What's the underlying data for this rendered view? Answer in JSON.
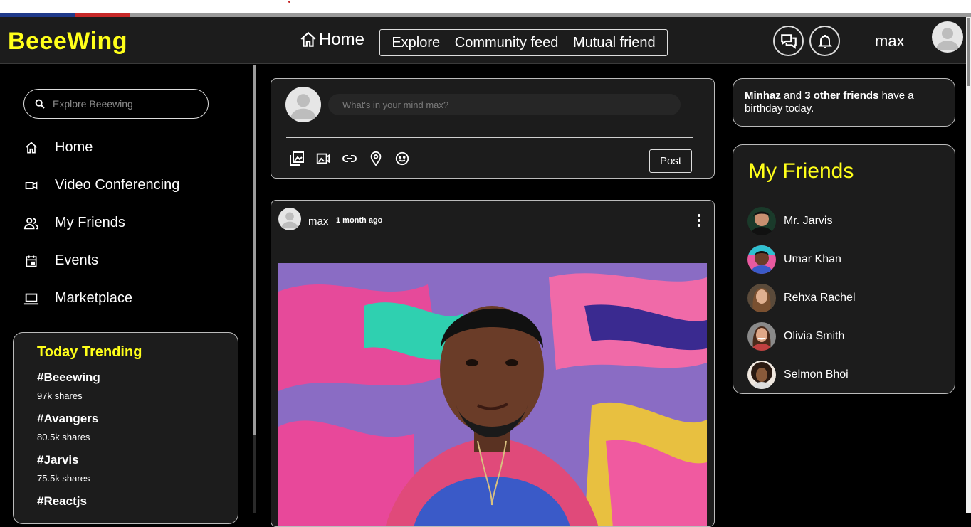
{
  "header": {
    "logo": "BeeeWing",
    "home_label": "Home",
    "nav_links": [
      "Explore",
      "Community feed",
      "Mutual friend"
    ],
    "username": "max"
  },
  "sidebar": {
    "search_placeholder": "Explore Beeewing",
    "items": [
      {
        "label": "Home",
        "icon": "home-icon"
      },
      {
        "label": "Video Conferencing",
        "icon": "video-camera-icon"
      },
      {
        "label": "My Friends",
        "icon": "people-icon"
      },
      {
        "label": "Events",
        "icon": "calendar-icon"
      },
      {
        "label": "Marketplace",
        "icon": "laptop-icon"
      }
    ],
    "trending": {
      "title": "Today Trending",
      "items": [
        {
          "tag": "#Beeewing",
          "shares": "97k shares"
        },
        {
          "tag": "#Avangers",
          "shares": "80.5k shares"
        },
        {
          "tag": "#Jarvis",
          "shares": "75.5k shares"
        },
        {
          "tag": "#Reactjs",
          "shares": ""
        }
      ]
    }
  },
  "composer": {
    "placeholder": "What's in your mind max?",
    "post_label": "Post",
    "tools": [
      "photo-library-icon",
      "image-icon",
      "link-icon",
      "location-pin-icon",
      "emoji-icon"
    ]
  },
  "post": {
    "author": "max",
    "time": "1 month ago"
  },
  "birthday": {
    "name": "Minhaz",
    "connector": "and",
    "others": "3 other friends",
    "text": "have a birthday today."
  },
  "friends": {
    "title": "My Friends",
    "items": [
      {
        "name": "Mr. Jarvis"
      },
      {
        "name": "Umar Khan"
      },
      {
        "name": "Rehxa Rachel"
      },
      {
        "name": "Olivia Smith"
      },
      {
        "name": "Selmon Bhoi"
      }
    ]
  },
  "colors": {
    "accent": "#ffff1a",
    "panel": "#1c1c1c",
    "background": "#000000"
  }
}
